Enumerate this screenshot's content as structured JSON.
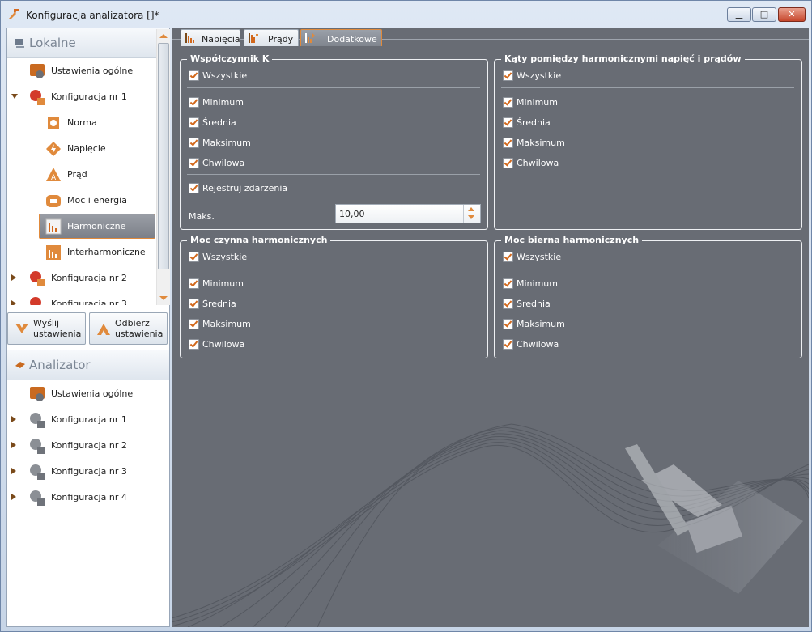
{
  "window": {
    "title": "Konfiguracja analizatora []*"
  },
  "lokalne": {
    "header": "Lokalne",
    "items": [
      {
        "label": "Ustawienia ogólne"
      },
      {
        "label": "Konfiguracja nr 1"
      },
      {
        "label": "Norma"
      },
      {
        "label": "Napięcie"
      },
      {
        "label": "Prąd"
      },
      {
        "label": "Moc i energia"
      },
      {
        "label": "Harmoniczne"
      },
      {
        "label": "Interharmoniczne"
      },
      {
        "label": "Konfiguracja nr 2"
      },
      {
        "label": "Konfiguracja nr 3"
      }
    ]
  },
  "actions": {
    "send_label": "Wyślij\nustawienia",
    "receive_label": "Odbierz\nustawienia"
  },
  "analizator": {
    "header": "Analizator",
    "items": [
      {
        "label": "Ustawienia ogólne"
      },
      {
        "label": "Konfiguracja nr 1"
      },
      {
        "label": "Konfiguracja nr 2"
      },
      {
        "label": "Konfiguracja nr 3"
      },
      {
        "label": "Konfiguracja nr 4"
      }
    ]
  },
  "tabs": [
    {
      "label": "Napięcia"
    },
    {
      "label": "Prądy"
    },
    {
      "label": "Dodatkowe"
    }
  ],
  "groups": {
    "k_factor": {
      "title": "Współczynnik K",
      "all": "Wszystkie",
      "min": "Minimum",
      "avg": "Średnia",
      "max": "Maksimum",
      "inst": "Chwilowa",
      "events": "Rejestruj zdarzenia",
      "maks_label": "Maks.",
      "maks_value": "10,00"
    },
    "angles": {
      "title": "Kąty pomiędzy harmonicznymi napięć i prądów",
      "all": "Wszystkie",
      "min": "Minimum",
      "avg": "Średnia",
      "max": "Maksimum",
      "inst": "Chwilowa"
    },
    "active_power": {
      "title": "Moc czynna harmonicznych",
      "all": "Wszystkie",
      "min": "Minimum",
      "avg": "Średnia",
      "max": "Maksimum",
      "inst": "Chwilowa"
    },
    "reactive_power": {
      "title": "Moc bierna harmonicznych",
      "all": "Wszystkie",
      "min": "Minimum",
      "avg": "Średnia",
      "max": "Maksimum",
      "inst": "Chwilowa"
    }
  },
  "colors": {
    "accent": "#e08a3c",
    "panel": "#686c74"
  }
}
